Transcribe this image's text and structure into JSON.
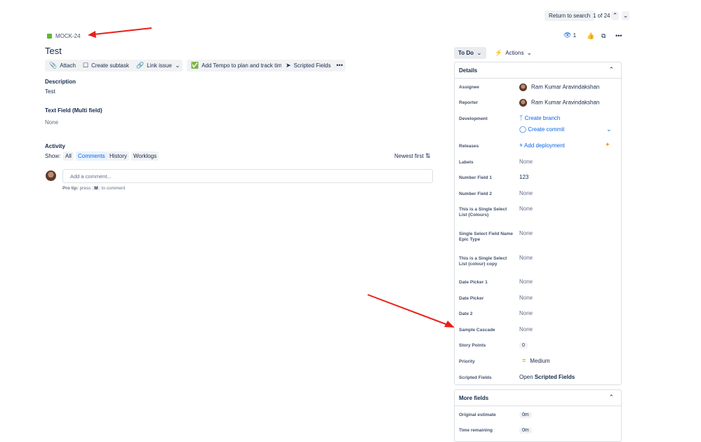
{
  "top": {
    "return_label": "Return to search",
    "pager": "1 of 24"
  },
  "issue": {
    "key": "MOCK-24",
    "title": "Test"
  },
  "toolbar": {
    "attach": "Attach",
    "subtask": "Create subtask",
    "link": "Link issue",
    "tempo": "Add Tempo to plan and track time",
    "scripted": "Scripted Fields"
  },
  "description": {
    "heading": "Description",
    "text": "Test"
  },
  "textfield": {
    "heading": "Text Field (Multi field)",
    "value": "None"
  },
  "activity": {
    "heading": "Activity",
    "show": "Show:",
    "tabs": [
      "All",
      "Comments",
      "History",
      "Worklogs"
    ],
    "sort": "Newest first",
    "comment_placeholder": "Add a comment...",
    "protip_a": "Pro tip:",
    "protip_b": "press",
    "protip_key": "M",
    "protip_c": "to comment"
  },
  "header_right": {
    "watchers": "1"
  },
  "status": {
    "todo": "To Do",
    "actions": "Actions"
  },
  "details": {
    "title": "Details",
    "assignee_label": "Assignee",
    "assignee": "Ram Kumar Aravindakshan",
    "reporter_label": "Reporter",
    "reporter": "Ram Kumar Aravindakshan",
    "development_label": "Development",
    "create_branch": "Create branch",
    "create_commit": "Create commit",
    "releases_label": "Releases",
    "add_deployment": "Add deployment",
    "labels_label": "Labels",
    "labels": "None",
    "num1_label": "Number Field 1",
    "num1": "123",
    "num2_label": "Number Field 2",
    "num2": "None",
    "ssl1_label": "This is a Single Select List (Colours)",
    "ssl1": "None",
    "ssl2_label": "Single Select Field Name Epic Type",
    "ssl2": "None",
    "ssl3_label": "This is a Single Select List (colour) copy",
    "ssl3": "None",
    "dp1_label": "Date Picker 1",
    "dp1": "None",
    "dp_label": "Date Picker",
    "dp": "None",
    "d2_label": "Date 2",
    "d2": "None",
    "cascade_label": "Sample Cascade",
    "cascade": "None",
    "sp_label": "Story Points",
    "sp": "0",
    "priority_label": "Priority",
    "priority": "Medium",
    "sf_label": "Scripted Fields",
    "sf_open": "Open",
    "sf_name": "Scripted Fields"
  },
  "more": {
    "title": "More fields",
    "orig_label": "Original estimate",
    "orig": "0m",
    "remain_label": "Time remaining",
    "remain": "0m"
  },
  "colors": {
    "accent": "#0c66e4",
    "annotation_arrow": "#e8201a",
    "priority": "#e2a01a",
    "issue_type": "#5eb82f"
  }
}
